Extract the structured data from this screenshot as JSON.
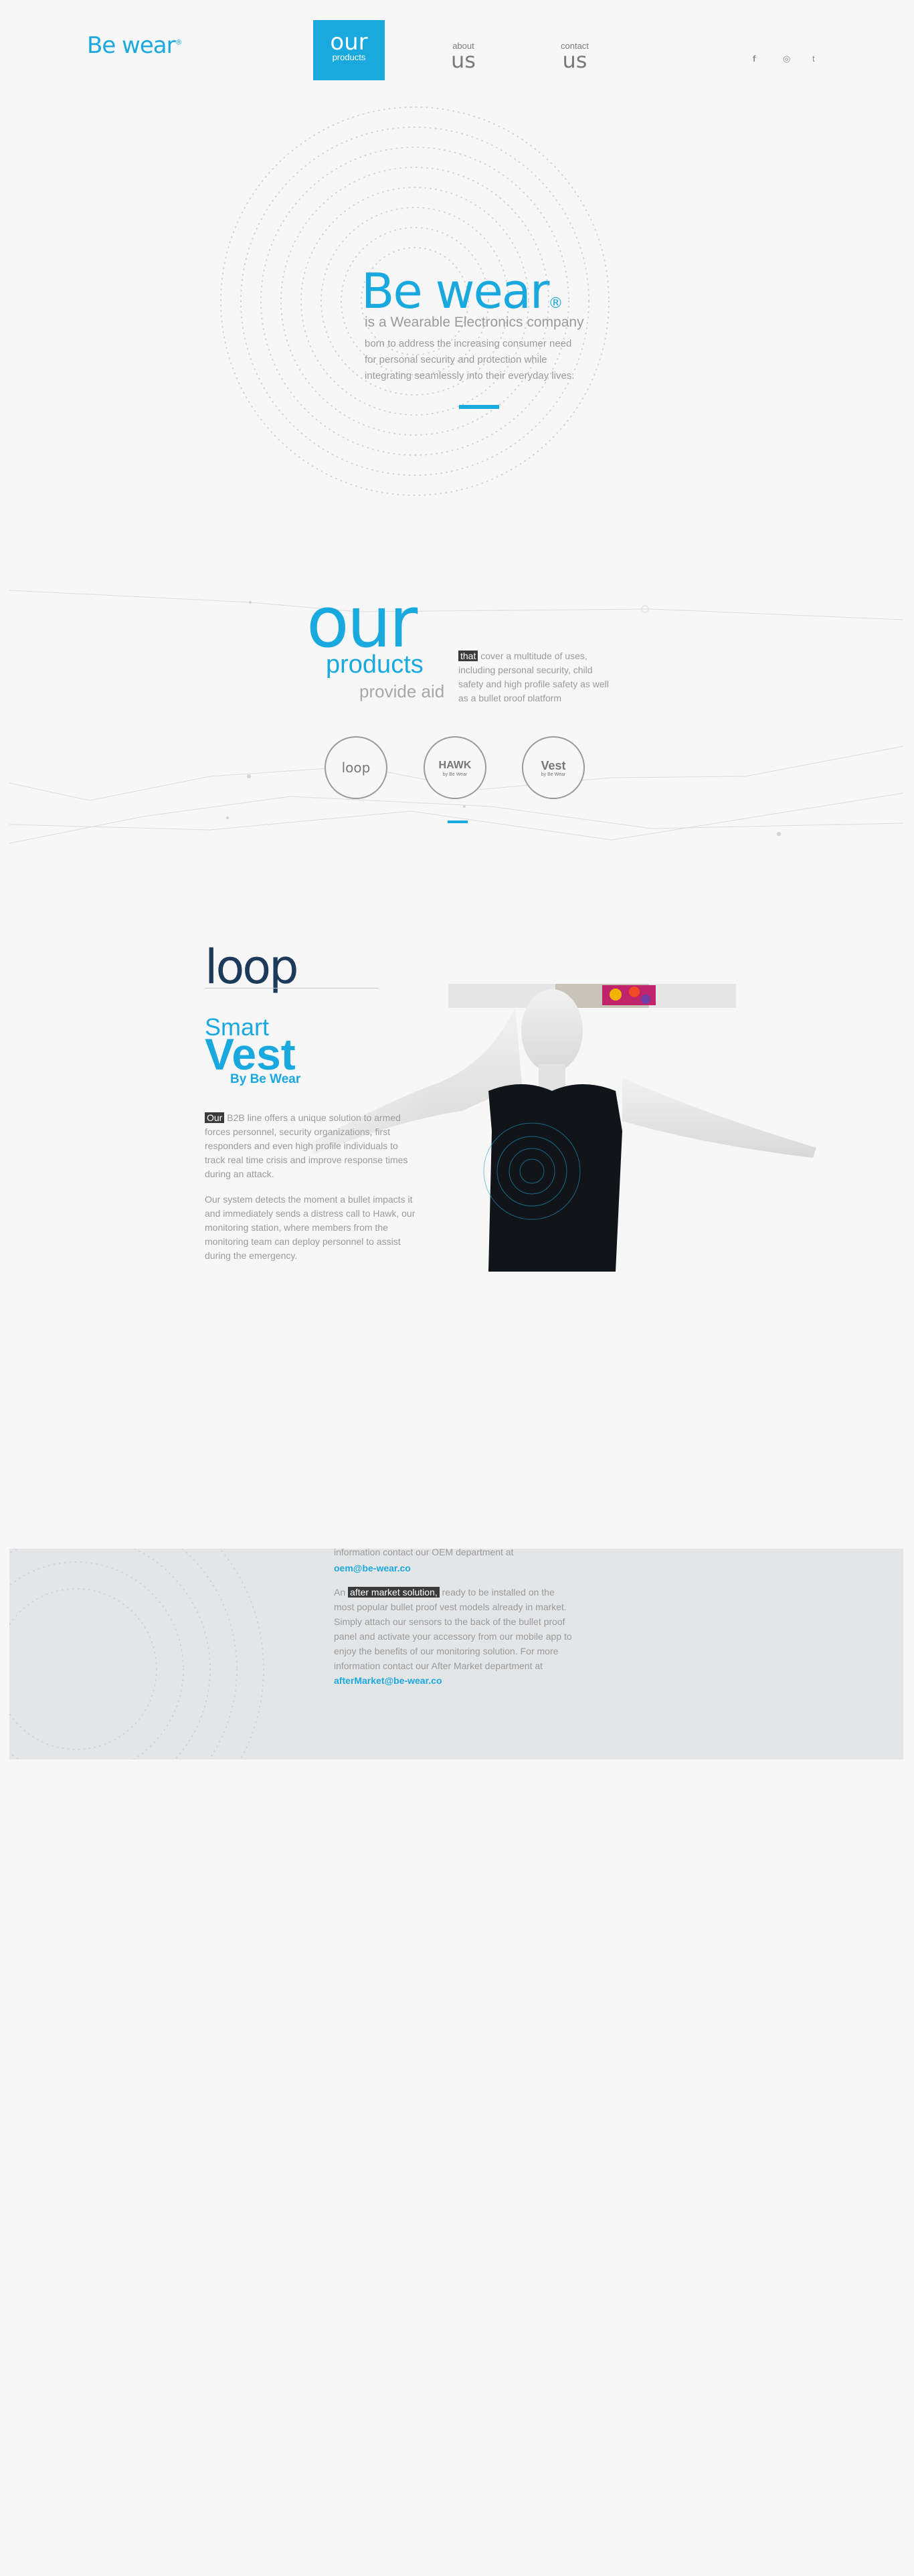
{
  "header": {
    "logo": "Be wear",
    "logo_reg": "®",
    "nav": [
      {
        "small": "products",
        "big": "our"
      },
      {
        "small": "about",
        "big": "us"
      },
      {
        "small": "contact",
        "big": "us"
      }
    ],
    "social": [
      "f",
      "◎",
      "t"
    ]
  },
  "hero": {
    "title": "Be wear",
    "reg": "®",
    "tagline": "is a Wearable Electronics company",
    "description": "born to address the increasing consumer need for personal security and protection while integrating seamlessly into their everyday lives."
  },
  "products": {
    "title_big": "our",
    "title_mid": "products",
    "title_small": "provide aid",
    "text_highlight": "that",
    "text_rest": "cover a multitude of uses, including personal security, child safety and high profile safety as well as a bullet proof platform",
    "circles": [
      {
        "main": "loop",
        "sub": ""
      },
      {
        "main": "HAWK",
        "sub": "by Be Wear"
      },
      {
        "main": "Vest",
        "sub": "by Be Wear"
      }
    ]
  },
  "vest": {
    "logo": "loop",
    "smart": "Smart",
    "vest": "Vest",
    "by": "By Be Wear",
    "p1_highlight": "Our",
    "p1_rest": "B2B line offers a unique solution to armed forces personnel, security organizations, first responders and even high profile individuals to track real time crisis and improve response times during an attack.",
    "p2": "Our system detects the moment a bullet impacts it and immediately sends a distress call to Hawk, our monitoring station, where members from the monitoring team can deploy personnel to assist during the emergency."
  },
  "band": {
    "line1": "information contact our OEM department at",
    "oem_email": "oem@be-wear.co",
    "p2_pre": "An",
    "p2_highlight": "after market solution,",
    "p2_rest": "ready to be installed on the most popular bullet proof vest models already in market. Simply attach our sensors to the back of the bullet proof panel and activate your accessory from our mobile app to enjoy the benefits of our monitoring solution. For more information contact our After Market department at",
    "am_email": "afterMarket@be-wear.co"
  },
  "colors": {
    "accent": "#19a9df",
    "dark": "#3a3a3a",
    "navy": "#1d3a5a",
    "band": "#e4e5e7"
  }
}
